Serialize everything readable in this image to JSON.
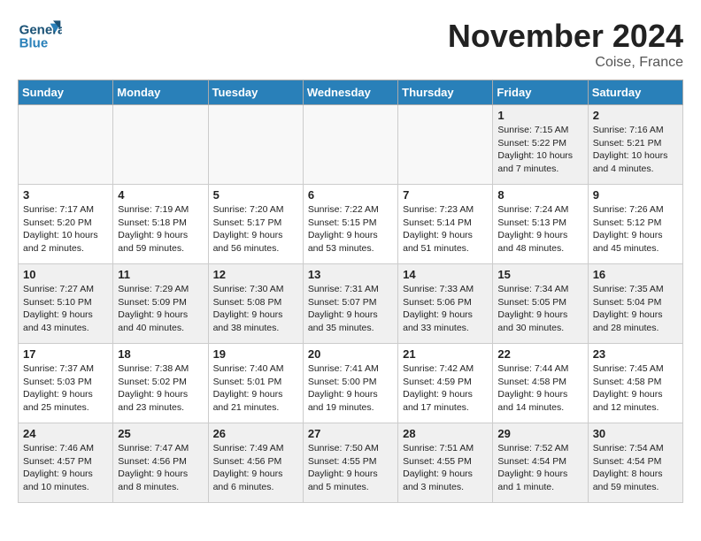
{
  "header": {
    "logo_text_top": "General",
    "logo_text_bottom": "Blue",
    "month_title": "November 2024",
    "location": "Coise, France"
  },
  "weekdays": [
    "Sunday",
    "Monday",
    "Tuesday",
    "Wednesday",
    "Thursday",
    "Friday",
    "Saturday"
  ],
  "weeks": [
    [
      {
        "day": "",
        "content": ""
      },
      {
        "day": "",
        "content": ""
      },
      {
        "day": "",
        "content": ""
      },
      {
        "day": "",
        "content": ""
      },
      {
        "day": "",
        "content": ""
      },
      {
        "day": "1",
        "content": "Sunrise: 7:15 AM\nSunset: 5:22 PM\nDaylight: 10 hours and 7 minutes."
      },
      {
        "day": "2",
        "content": "Sunrise: 7:16 AM\nSunset: 5:21 PM\nDaylight: 10 hours and 4 minutes."
      }
    ],
    [
      {
        "day": "3",
        "content": "Sunrise: 7:17 AM\nSunset: 5:20 PM\nDaylight: 10 hours and 2 minutes."
      },
      {
        "day": "4",
        "content": "Sunrise: 7:19 AM\nSunset: 5:18 PM\nDaylight: 9 hours and 59 minutes."
      },
      {
        "day": "5",
        "content": "Sunrise: 7:20 AM\nSunset: 5:17 PM\nDaylight: 9 hours and 56 minutes."
      },
      {
        "day": "6",
        "content": "Sunrise: 7:22 AM\nSunset: 5:15 PM\nDaylight: 9 hours and 53 minutes."
      },
      {
        "day": "7",
        "content": "Sunrise: 7:23 AM\nSunset: 5:14 PM\nDaylight: 9 hours and 51 minutes."
      },
      {
        "day": "8",
        "content": "Sunrise: 7:24 AM\nSunset: 5:13 PM\nDaylight: 9 hours and 48 minutes."
      },
      {
        "day": "9",
        "content": "Sunrise: 7:26 AM\nSunset: 5:12 PM\nDaylight: 9 hours and 45 minutes."
      }
    ],
    [
      {
        "day": "10",
        "content": "Sunrise: 7:27 AM\nSunset: 5:10 PM\nDaylight: 9 hours and 43 minutes."
      },
      {
        "day": "11",
        "content": "Sunrise: 7:29 AM\nSunset: 5:09 PM\nDaylight: 9 hours and 40 minutes."
      },
      {
        "day": "12",
        "content": "Sunrise: 7:30 AM\nSunset: 5:08 PM\nDaylight: 9 hours and 38 minutes."
      },
      {
        "day": "13",
        "content": "Sunrise: 7:31 AM\nSunset: 5:07 PM\nDaylight: 9 hours and 35 minutes."
      },
      {
        "day": "14",
        "content": "Sunrise: 7:33 AM\nSunset: 5:06 PM\nDaylight: 9 hours and 33 minutes."
      },
      {
        "day": "15",
        "content": "Sunrise: 7:34 AM\nSunset: 5:05 PM\nDaylight: 9 hours and 30 minutes."
      },
      {
        "day": "16",
        "content": "Sunrise: 7:35 AM\nSunset: 5:04 PM\nDaylight: 9 hours and 28 minutes."
      }
    ],
    [
      {
        "day": "17",
        "content": "Sunrise: 7:37 AM\nSunset: 5:03 PM\nDaylight: 9 hours and 25 minutes."
      },
      {
        "day": "18",
        "content": "Sunrise: 7:38 AM\nSunset: 5:02 PM\nDaylight: 9 hours and 23 minutes."
      },
      {
        "day": "19",
        "content": "Sunrise: 7:40 AM\nSunset: 5:01 PM\nDaylight: 9 hours and 21 minutes."
      },
      {
        "day": "20",
        "content": "Sunrise: 7:41 AM\nSunset: 5:00 PM\nDaylight: 9 hours and 19 minutes."
      },
      {
        "day": "21",
        "content": "Sunrise: 7:42 AM\nSunset: 4:59 PM\nDaylight: 9 hours and 17 minutes."
      },
      {
        "day": "22",
        "content": "Sunrise: 7:44 AM\nSunset: 4:58 PM\nDaylight: 9 hours and 14 minutes."
      },
      {
        "day": "23",
        "content": "Sunrise: 7:45 AM\nSunset: 4:58 PM\nDaylight: 9 hours and 12 minutes."
      }
    ],
    [
      {
        "day": "24",
        "content": "Sunrise: 7:46 AM\nSunset: 4:57 PM\nDaylight: 9 hours and 10 minutes."
      },
      {
        "day": "25",
        "content": "Sunrise: 7:47 AM\nSunset: 4:56 PM\nDaylight: 9 hours and 8 minutes."
      },
      {
        "day": "26",
        "content": "Sunrise: 7:49 AM\nSunset: 4:56 PM\nDaylight: 9 hours and 6 minutes."
      },
      {
        "day": "27",
        "content": "Sunrise: 7:50 AM\nSunset: 4:55 PM\nDaylight: 9 hours and 5 minutes."
      },
      {
        "day": "28",
        "content": "Sunrise: 7:51 AM\nSunset: 4:55 PM\nDaylight: 9 hours and 3 minutes."
      },
      {
        "day": "29",
        "content": "Sunrise: 7:52 AM\nSunset: 4:54 PM\nDaylight: 9 hours and 1 minute."
      },
      {
        "day": "30",
        "content": "Sunrise: 7:54 AM\nSunset: 4:54 PM\nDaylight: 8 hours and 59 minutes."
      }
    ]
  ]
}
